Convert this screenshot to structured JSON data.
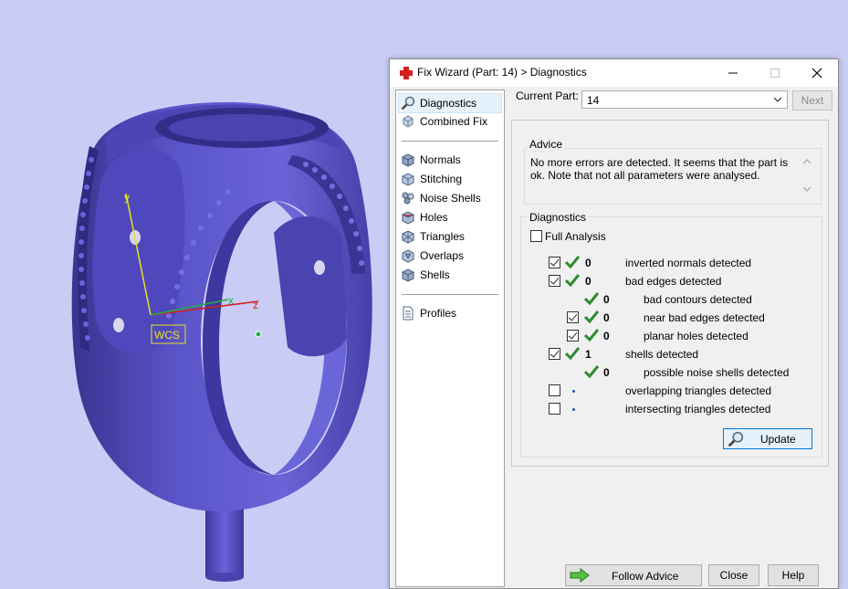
{
  "viewport": {
    "wcs_label": "WCS",
    "axis_labels": {
      "x": "x",
      "y": "y",
      "z": "z"
    },
    "colors": {
      "background": "#c9cdf6",
      "model": "#5b55c8",
      "model_dark": "#3d37a0",
      "model_light": "#8a85e6"
    }
  },
  "dialog": {
    "title": "Fix Wizard (Part: 14) > Diagnostics",
    "nav_items": [
      {
        "label": "Diagnostics",
        "icon": "magnifier-icon"
      },
      {
        "label": "Combined Fix",
        "icon": "cube-icon"
      },
      {
        "label": "Normals",
        "icon": "normals-icon"
      },
      {
        "label": "Stitching",
        "icon": "stitching-icon"
      },
      {
        "label": "Noise Shells",
        "icon": "noise-shells-icon"
      },
      {
        "label": "Holes",
        "icon": "holes-icon"
      },
      {
        "label": "Triangles",
        "icon": "triangles-icon"
      },
      {
        "label": "Overlaps",
        "icon": "overlaps-icon"
      },
      {
        "label": "Shells",
        "icon": "shells-icon"
      },
      {
        "label": "Profiles",
        "icon": "document-icon"
      }
    ],
    "current_part_label": "Current Part:",
    "current_part_value": "14",
    "next_label": "Next",
    "advice": {
      "title": "Advice",
      "text": "No more errors are detected. It seems that the part is ok. Note that not all parameters were analysed."
    },
    "diagnostics": {
      "title": "Diagnostics",
      "full_analysis_label": "Full Analysis",
      "full_analysis_checked": false,
      "rows": [
        {
          "checkbox": true,
          "checked": true,
          "status": "ok",
          "count": "0",
          "label": "inverted normals detected"
        },
        {
          "checkbox": true,
          "checked": true,
          "status": "ok",
          "count": "0",
          "label": "bad edges detected"
        },
        {
          "checkbox": false,
          "checked": false,
          "status": "ok",
          "count": "0",
          "label": "bad contours detected"
        },
        {
          "checkbox": true,
          "checked": true,
          "status": "ok",
          "count": "0",
          "label": "near bad edges detected"
        },
        {
          "checkbox": true,
          "checked": true,
          "status": "ok",
          "count": "0",
          "label": "planar holes detected"
        },
        {
          "checkbox": true,
          "checked": true,
          "status": "ok",
          "count": "1",
          "label": "shells detected"
        },
        {
          "checkbox": false,
          "checked": false,
          "status": "ok",
          "count": "0",
          "label": "possible noise shells detected"
        },
        {
          "checkbox": true,
          "checked": false,
          "status": "pending",
          "count": "",
          "label": "overlapping triangles detected"
        },
        {
          "checkbox": true,
          "checked": false,
          "status": "pending",
          "count": "",
          "label": "intersecting triangles detected"
        }
      ],
      "update_label": "Update"
    },
    "buttons": {
      "follow_advice": "Follow Advice",
      "close": "Close",
      "help": "Help"
    },
    "colors": {
      "tick": "#2e8b2e",
      "pending_dot": "#2050b0",
      "selected_bg": "#e5f1fb",
      "accent": "#0078d7"
    }
  }
}
